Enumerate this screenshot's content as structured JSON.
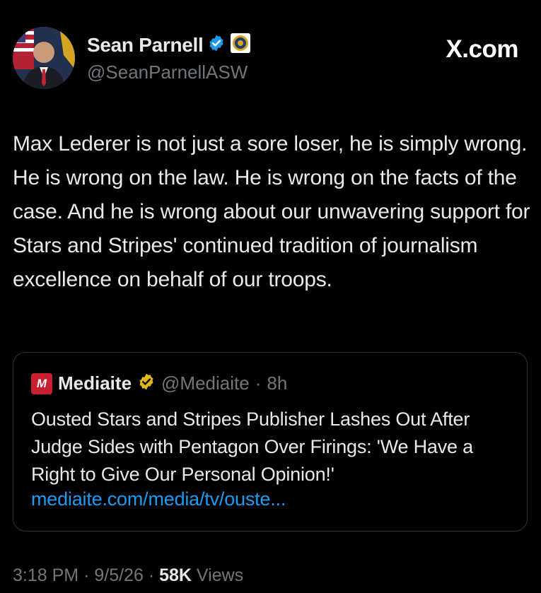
{
  "author": {
    "display_name": "Sean Parnell",
    "handle": "@SeanParnellASW"
  },
  "watermark": "X.com",
  "tweet": {
    "text": "Max Lederer is not just a sore loser, he is simply wrong. He is wrong on the law. He is wrong on the facts of the case. And he is wrong about our unwavering support for Stars and Stripes' continued tradition of journalism excellence on behalf of our troops."
  },
  "quote": {
    "logo_letter": "M",
    "name": "Mediaite",
    "handle": "@Mediaite",
    "separator": "·",
    "time": "8h",
    "text": "Ousted Stars and Stripes Publisher Lashes Out After Judge Sides with Pentagon Over Firings: 'We Have a Right to Give Our Personal Opinion!'",
    "link": "mediaite.com/media/tv/ouste..."
  },
  "meta": {
    "time": "3:18 PM",
    "sep": "·",
    "date": "9/5/26",
    "views_count": "58K",
    "views_label": "Views"
  },
  "colors": {
    "background": "#000000",
    "text": "#e7e9ea",
    "muted": "#71767b",
    "link": "#1d9bf0",
    "verified_blue": "#1d9bf0",
    "verified_gold": "#e2b719",
    "mediaite_red": "#c8202f"
  },
  "icons": [
    "avatar",
    "verified-blue-icon",
    "dod-seal-icon",
    "mediaite-logo-icon",
    "verified-gold-icon"
  ]
}
